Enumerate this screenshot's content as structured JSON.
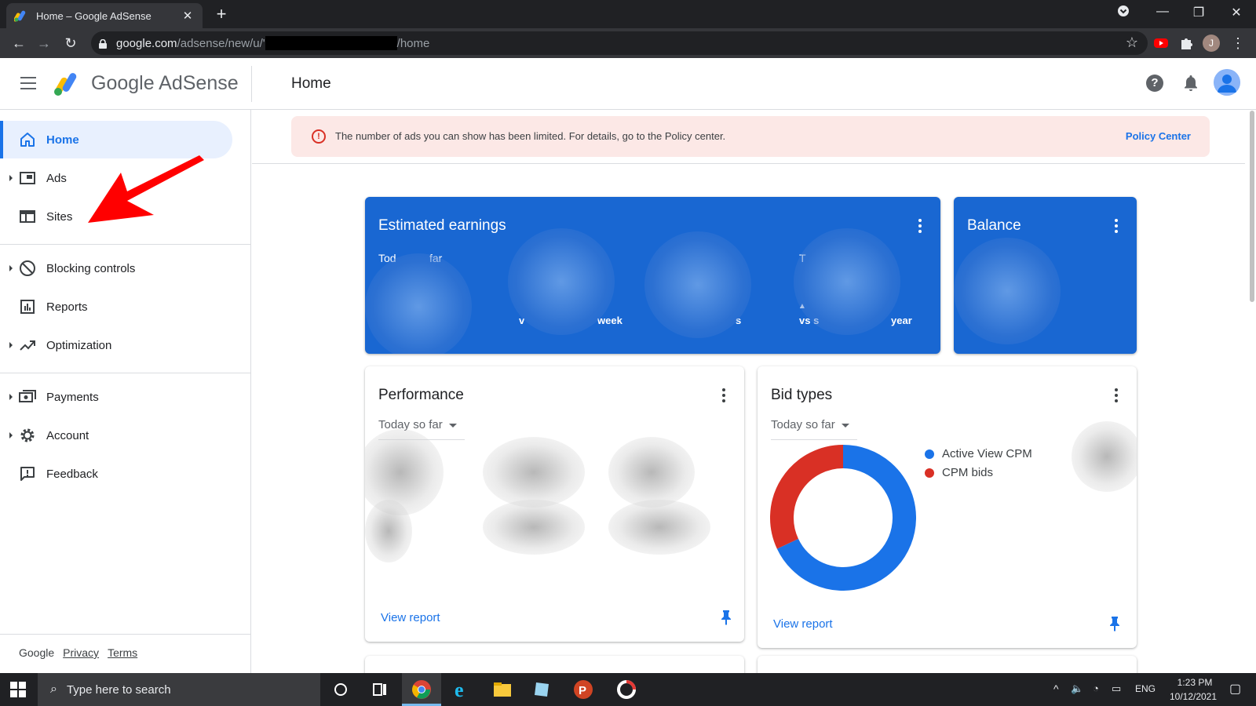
{
  "browser": {
    "tab_title": "Home – Google AdSense",
    "url_host": "google.com",
    "url_path_prefix": "/adsense/new/u/'",
    "url_path_suffix": "/home",
    "profile_initial": "J"
  },
  "app": {
    "brand": "Google AdSense",
    "page_title": "Home"
  },
  "sidebar": {
    "items": [
      {
        "label": "Home",
        "icon": "home-icon",
        "active": true
      },
      {
        "label": "Ads",
        "icon": "ads-icon"
      },
      {
        "label": "Sites",
        "icon": "sites-icon"
      },
      {
        "label": "Blocking controls",
        "icon": "block-icon"
      },
      {
        "label": "Reports",
        "icon": "reports-icon"
      },
      {
        "label": "Optimization",
        "icon": "trending-icon"
      },
      {
        "label": "Payments",
        "icon": "payments-icon"
      },
      {
        "label": "Account",
        "icon": "gear-icon"
      },
      {
        "label": "Feedback",
        "icon": "feedback-icon"
      }
    ],
    "footer": {
      "google": "Google",
      "privacy": "Privacy",
      "terms": "Terms"
    }
  },
  "banner": {
    "message": "The number of ads you can show has been limited. For details, go to the Policy center.",
    "action": "Policy Center"
  },
  "cards": {
    "estimated_earnings": {
      "title": "Estimated earnings",
      "fragment_today": "Tod",
      "fragment_far": "far",
      "fragment_t": "T",
      "fragment_v": "v",
      "fragment_week": "week",
      "fragment_s": "s",
      "fragment_vs": "vs s",
      "fragment_year": "year"
    },
    "balance": {
      "title": "Balance"
    },
    "performance": {
      "title": "Performance",
      "period": "Today so far",
      "link": "View report"
    },
    "bid_types": {
      "title": "Bid types",
      "period": "Today so far",
      "link": "View report",
      "legend": [
        "Active View CPM",
        "CPM bids"
      ]
    }
  },
  "chart_data": {
    "type": "pie",
    "categories": [
      "Active View CPM",
      "CPM bids"
    ],
    "values": [
      0.68,
      0.32
    ],
    "colors": [
      "#1a73e8",
      "#d93025"
    ]
  },
  "taskbar": {
    "search_placeholder": "Type here to search",
    "lang": "ENG",
    "time": "1:23 PM",
    "date": "10/12/2021"
  }
}
